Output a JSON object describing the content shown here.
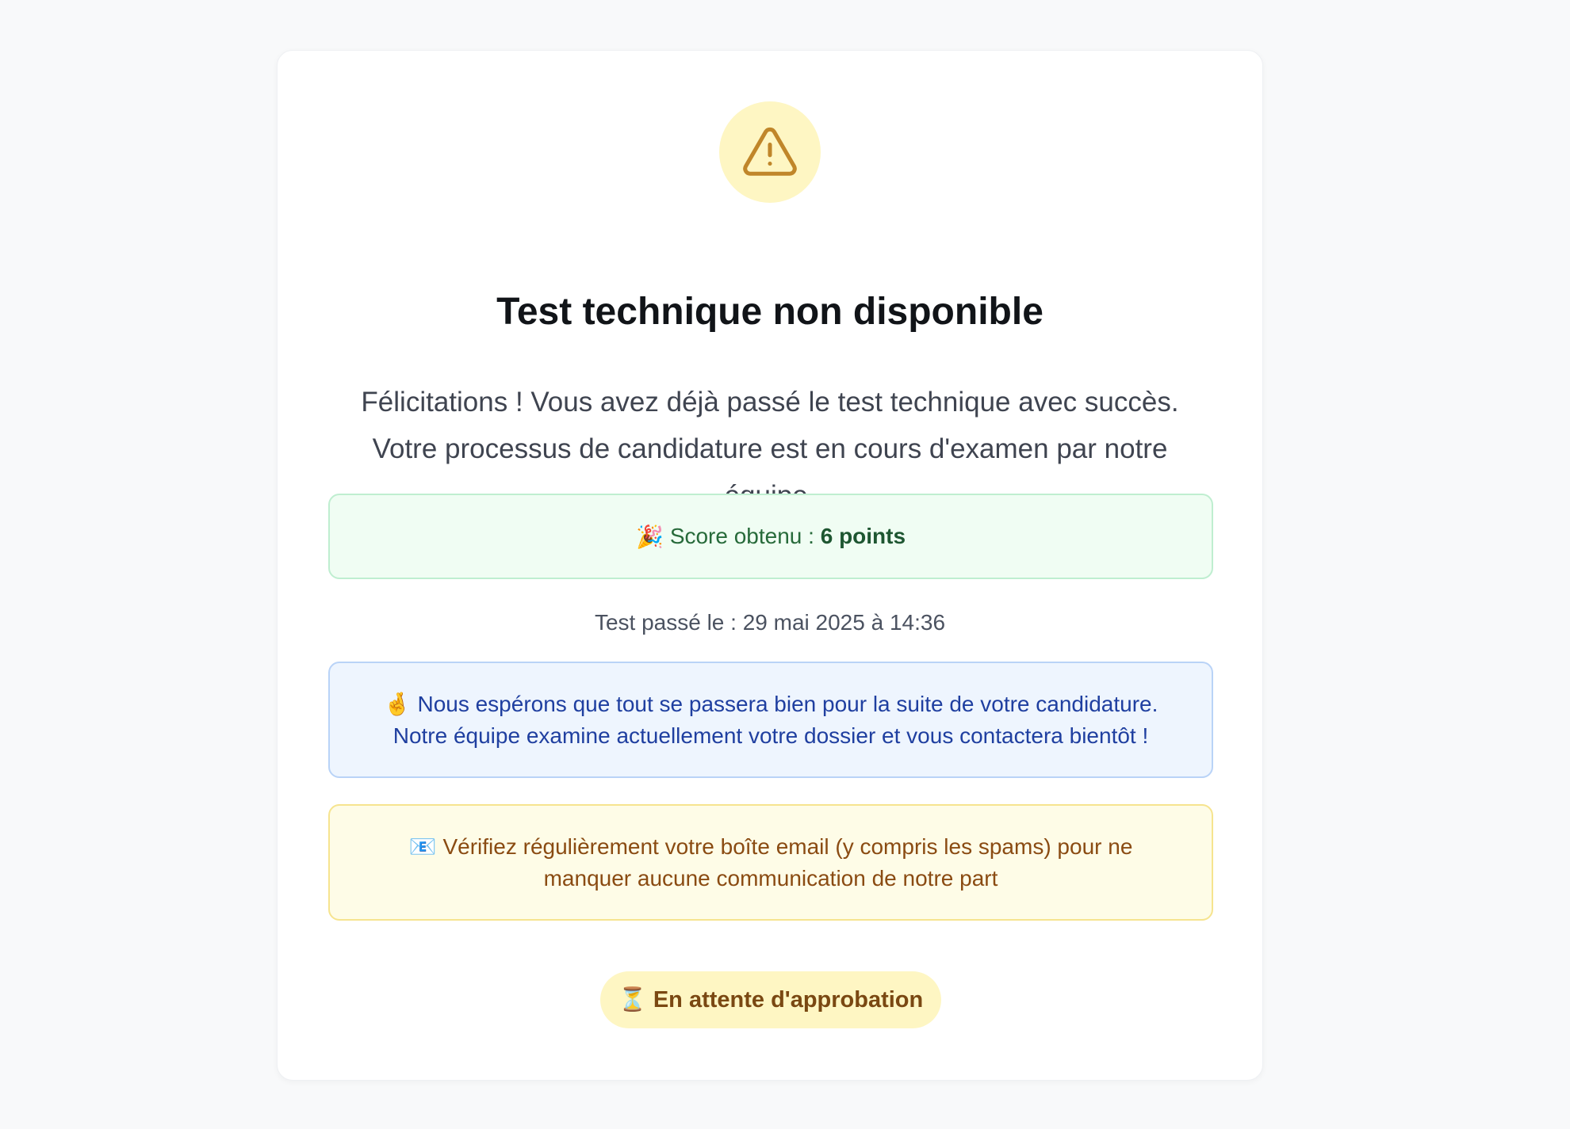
{
  "title": "Test technique non disponible",
  "message": "Félicitations ! Vous avez déjà passé le test technique avec succès. Votre processus de candidature est en cours d'examen par notre équipe.",
  "score": {
    "emoji": "🎉",
    "label": "Score obtenu :",
    "value": "6 points"
  },
  "test_date": "Test passé le : 29 mai 2025 à 14:36",
  "info": {
    "emoji": "🤞",
    "text": "Nous espérons que tout se passera bien pour la suite de votre candidature. Notre équipe examine actuellement votre dossier et vous contactera bientôt !"
  },
  "email_notice": {
    "emoji": "📧",
    "text": "Vérifiez régulièrement votre boîte email (y compris les spams) pour ne manquer aucune communication de notre part"
  },
  "status_badge": {
    "emoji": "⏳",
    "label": "En attente d'approbation"
  },
  "colors": {
    "warning_icon": "#c0862a",
    "warning_bg": "#fef6c3",
    "success_bg": "#f0fdf3",
    "info_bg": "#eef5fe",
    "notice_bg": "#fefce7"
  },
  "icons": {
    "header": "warning-triangle-icon"
  }
}
